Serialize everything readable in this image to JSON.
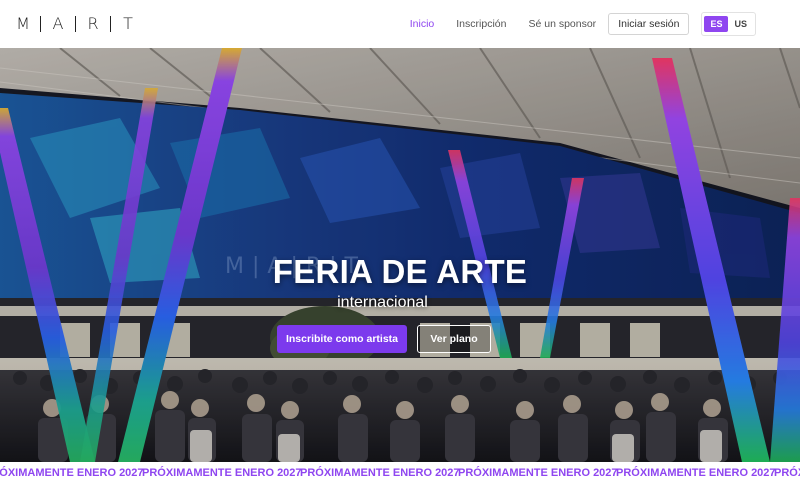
{
  "brand": {
    "letters": [
      "M",
      "A",
      "R",
      "T"
    ]
  },
  "nav": {
    "items": [
      {
        "label": "Inicio",
        "active": true
      },
      {
        "label": "Inscripción",
        "active": false
      },
      {
        "label": "Sé un sponsor",
        "active": false
      }
    ],
    "login_label": "Iniciar sesión",
    "languages": {
      "es": "ES",
      "us": "US",
      "selected": "ES"
    }
  },
  "hero": {
    "title": "FERIA DE ARTE",
    "subtitle": "internacional",
    "primary_cta": "Inscribite como artista",
    "secondary_cta": "Ver plano"
  },
  "marquee": {
    "text": "PRÓXIMAMENTE ENERO 2027",
    "separator": "·",
    "repeat": 6
  },
  "colors": {
    "accent": "#8f46f0",
    "button": "#7c3aed",
    "hero_bg": "#0d1330"
  }
}
